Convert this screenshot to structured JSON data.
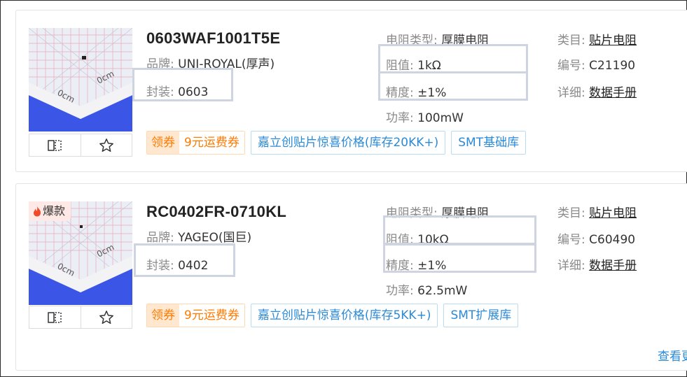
{
  "products": [
    {
      "part_no": "0603WAF1001T5E",
      "brand_label": "品牌:",
      "brand": "UNI-ROYAL(厚声)",
      "package_label": "封装:",
      "package": "0603",
      "resistor_type_label": "电阻类型:",
      "resistor_type": "厚膜电阻",
      "resistance_label": "阻值:",
      "resistance": "1kΩ",
      "tolerance_label": "精度:",
      "tolerance": "±1%",
      "power_label": "功率:",
      "power": "100mW",
      "category_label": "类目:",
      "category": "贴片电阻",
      "code_label": "编号:",
      "code": "C21190",
      "detail_label": "详细:",
      "detail": "数据手册",
      "coupon_left": "领券",
      "coupon_right": "9元运费券",
      "tag_promo": "嘉立创贴片惊喜价格(库存20KK+)",
      "tag_lib": "SMT基础库"
    },
    {
      "hot_label": "爆款",
      "part_no": "RC0402FR-0710KL",
      "brand_label": "品牌:",
      "brand": "YAGEO(国巨)",
      "package_label": "封装:",
      "package": "0402",
      "resistor_type_label": "电阻类型:",
      "resistor_type": "厚膜电阻",
      "resistance_label": "阻值:",
      "resistance": "10kΩ",
      "tolerance_label": "精度:",
      "tolerance": "±1%",
      "power_label": "功率:",
      "power": "62.5mW",
      "category_label": "类目:",
      "category": "贴片电阻",
      "code_label": "编号:",
      "code": "C60490",
      "detail_label": "详细:",
      "detail": "数据手册",
      "coupon_left": "领券",
      "coupon_right": "9元运费券",
      "tag_promo": "嘉立创贴片惊喜价格(库存5KK+)",
      "tag_lib": "SMT扩展库"
    }
  ],
  "overlay_labels": {
    "package": "封装",
    "resistance": "阻值",
    "tolerance": "精度"
  },
  "more_link": "查看更",
  "icons": {
    "compare": "compare-icon",
    "favorite": "star-icon",
    "hot": "flame-icon"
  },
  "colors": {
    "accent_blue": "#2b8ad8",
    "coupon_orange": "#ff7a00",
    "highlight_box": "#cfd5e0",
    "overlay_text": "#384a66"
  }
}
